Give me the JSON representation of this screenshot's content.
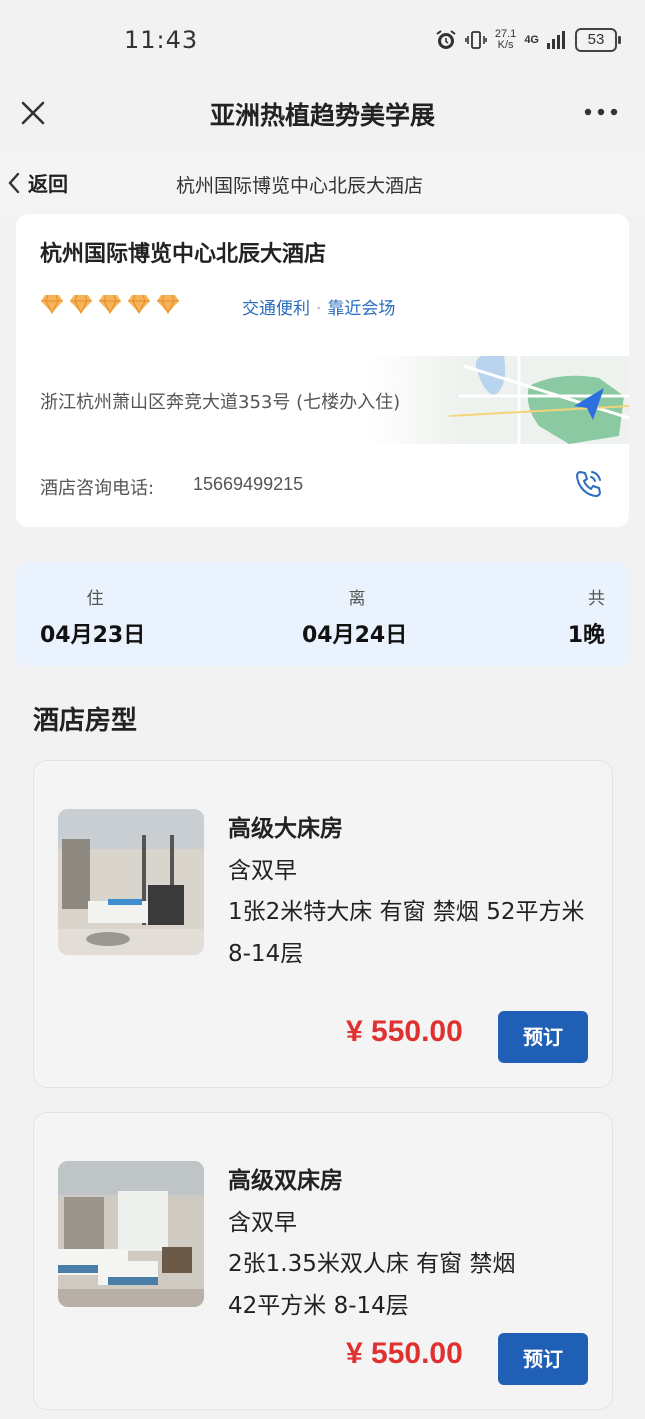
{
  "status_bar": {
    "time": "11:43",
    "net_speed_top": "27.1",
    "net_speed_bottom": "K/s",
    "network": "4G",
    "battery": "53"
  },
  "title_bar": {
    "title": "亚洲热植趋势美学展"
  },
  "nav_bar": {
    "back_label": "返回",
    "title": "杭州国际博览中心北辰大酒店"
  },
  "hotel": {
    "name": "杭州国际博览中心北辰大酒店",
    "diamond_rating": 5,
    "tags": [
      "交通便利",
      "靠近会场"
    ],
    "address": "浙江杭州萧山区奔竞大道353号 (七楼办入住)",
    "phone_label": "酒店咨询电话:",
    "phone": "15669499215"
  },
  "stay": {
    "checkin_label": "住",
    "checkin_date": "04月23日",
    "checkout_label": "离",
    "checkout_date": "04月24日",
    "nights_label": "共",
    "nights": "1晚"
  },
  "rooms_section_title": "酒店房型",
  "rooms": [
    {
      "name": "高级大床房",
      "breakfast": "含双早",
      "description": "1张2米特大床 有窗 禁烟 52平方米 8-14层",
      "price": "¥ 550.00",
      "book_label": "预订"
    },
    {
      "name": "高级双床房",
      "breakfast": "含双早",
      "description": "2张1.35米双人床 有窗 禁烟 42平方米 8-14层",
      "price": "¥ 550.00",
      "book_label": "预订"
    }
  ],
  "colors": {
    "accent": "#1f5fb5",
    "price": "#e03131",
    "tag": "#2a6dbf",
    "date_bg": "#eaf3fd"
  }
}
